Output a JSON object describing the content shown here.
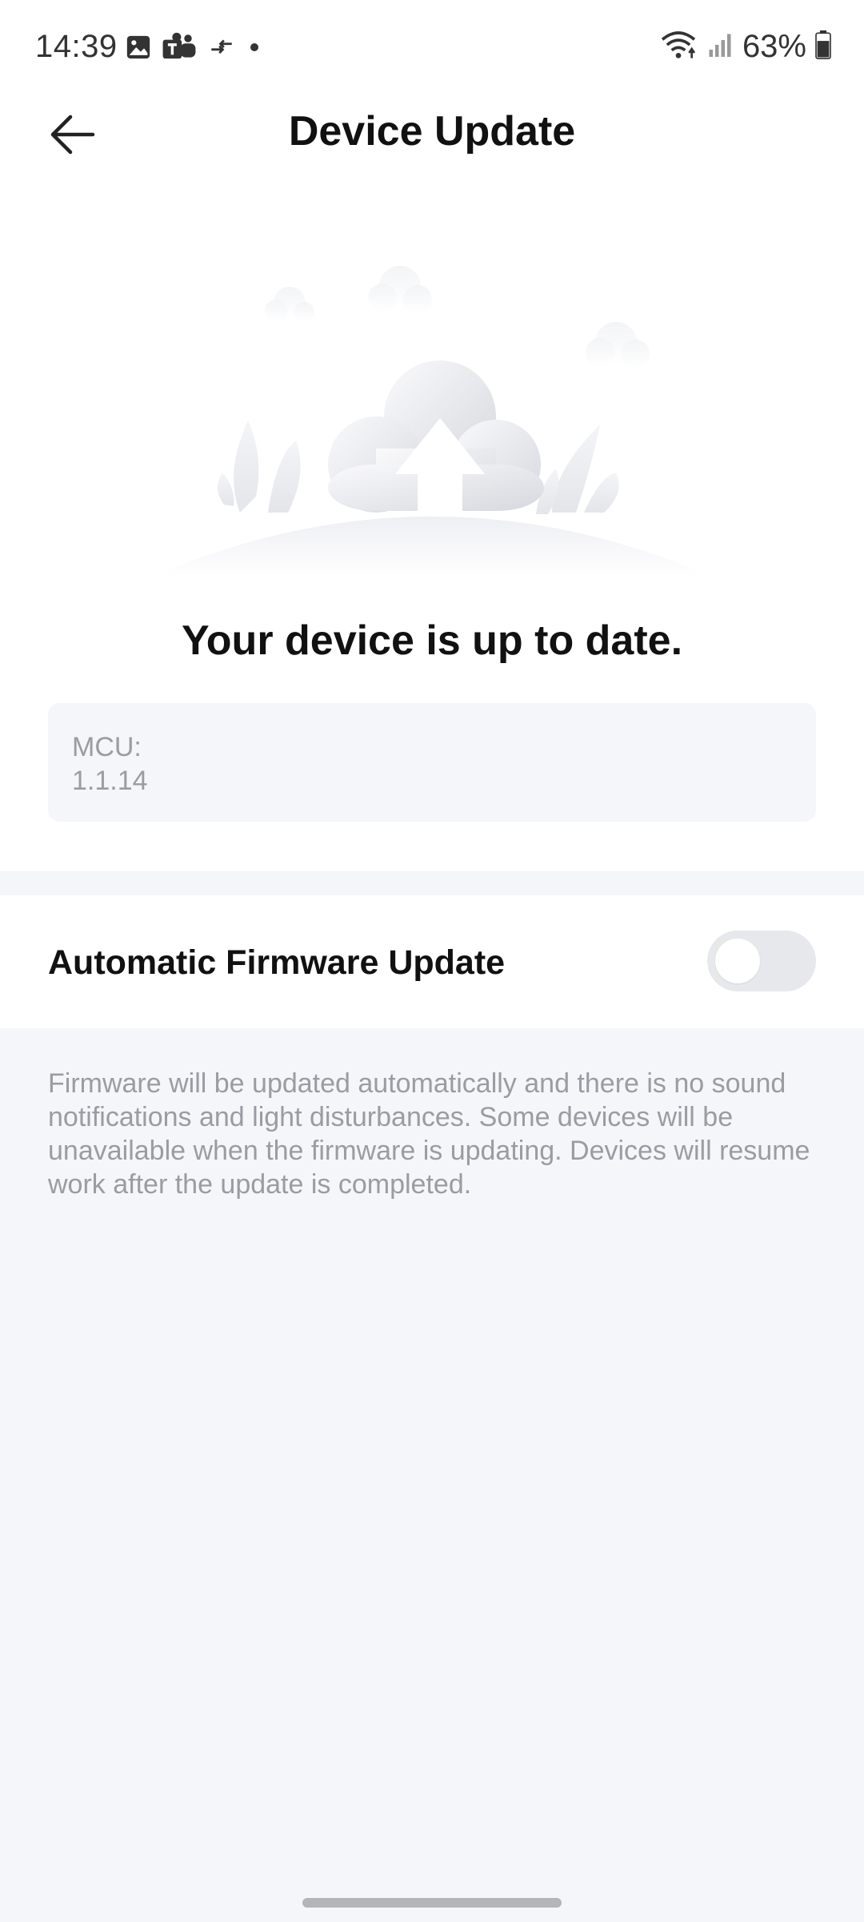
{
  "status_bar": {
    "time": "14:39",
    "battery": "63%",
    "left_icons": [
      "gallery-icon",
      "teams-icon",
      "data-transfer-icon",
      "dot-icon"
    ],
    "right_icons": [
      "wifi-icon",
      "signal-icon",
      "battery-icon"
    ]
  },
  "header": {
    "title": "Device Update",
    "back_icon": "back-arrow-icon"
  },
  "main": {
    "status_message": "Your device is up to date.",
    "version": {
      "label": "MCU:",
      "value": "1.1.14"
    }
  },
  "settings": {
    "auto_update_label": "Automatic Firmware Update",
    "auto_update_enabled": false,
    "description": "Firmware will be updated automatically and there is no sound notifications and light disturbances. Some devices will be unavailable when the firmware is updating. Devices will resume work after the update is completed."
  },
  "colors": {
    "background": "#f5f6fa",
    "card": "#ffffff",
    "title_text": "#111111",
    "muted_text": "#9a9ca3",
    "toggle_off": "#e7e8ec"
  }
}
